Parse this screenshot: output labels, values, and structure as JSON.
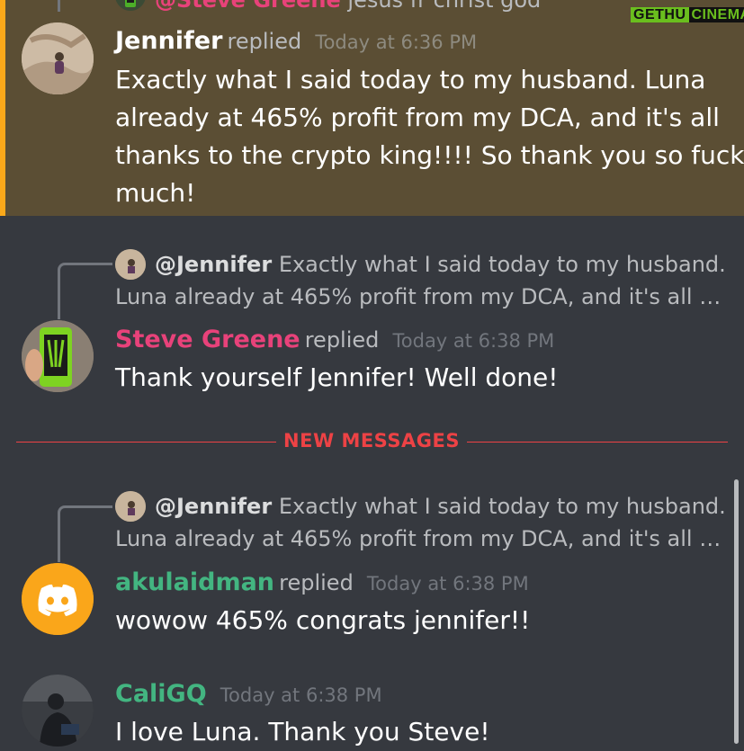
{
  "watermark": {
    "part1": "GETHU",
    "part2": "CINEMA"
  },
  "top_partial": {
    "mention": "@Steve Greene",
    "text": "jesus fr christ god"
  },
  "messages": [
    {
      "author": "Jennifer",
      "author_color": "#ffffff",
      "replied": "replied",
      "timestamp": "Today at 6:36 PM",
      "lines": [
        "Exactly what I said today to my husband. Luna",
        "already at 465% profit from my DCA, and it's all",
        "thanks to the crypto king!!!! So thank you so fucken",
        "much!"
      ],
      "highlighted": true
    },
    {
      "reply_to": {
        "mention": "@Jennifer",
        "line1": "Exactly what I said today to my husband.",
        "line2": "Luna already at 465% profit from my DCA, and it's all …"
      },
      "author": "Steve Greene",
      "author_color": "#e8427a",
      "replied": "replied",
      "timestamp": "Today at 6:38 PM",
      "lines": [
        "Thank yourself Jennifer! Well done!"
      ]
    },
    {
      "reply_to": {
        "mention": "@Jennifer",
        "line1": "Exactly what I said today to my husband.",
        "line2": "Luna already at 465% profit from my DCA, and it's all …"
      },
      "author": "akulaidman",
      "author_color": "#43b581",
      "replied": "replied",
      "timestamp": "Today at 6:38 PM",
      "lines": [
        "wowow 465% congrats jennifer!!"
      ]
    },
    {
      "author": "CaliGQ",
      "author_color": "#43b581",
      "timestamp": "Today at 6:38 PM",
      "lines": [
        "I love Luna. Thank you Steve!"
      ]
    }
  ],
  "divider": {
    "label": "NEW MESSAGES",
    "color": "#ed4245"
  },
  "colors": {
    "background": "#36393f",
    "highlight_bg": "#5b4e34",
    "highlight_bar": "#faa81a",
    "muted": "#72767d"
  },
  "icons": {
    "discord_avatar": "discord-logo-icon"
  }
}
